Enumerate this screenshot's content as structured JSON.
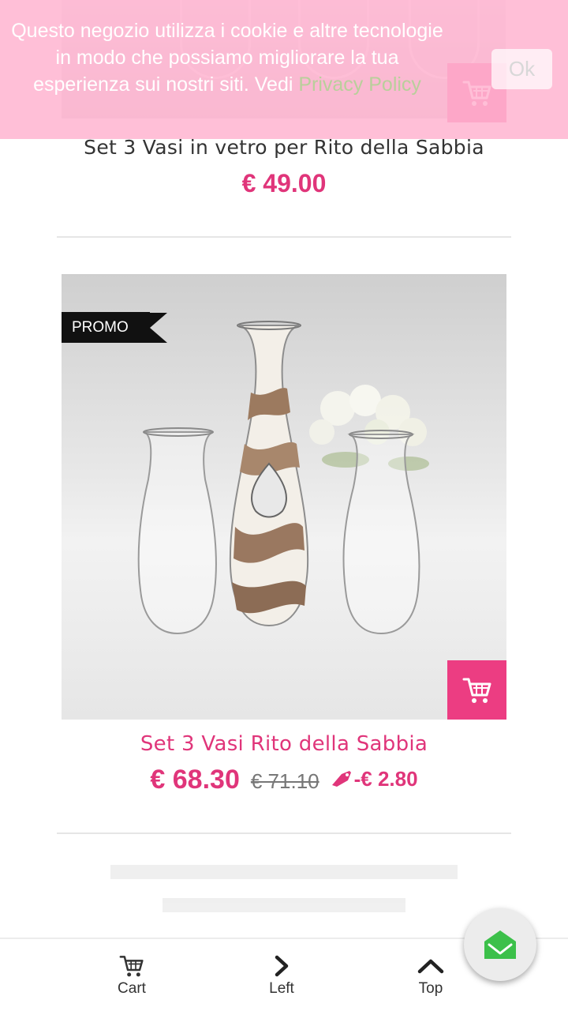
{
  "cookie_banner": {
    "text": "Questo negozio utilizza i cookie e altre tecnologie in modo che possiamo migliorare la tua esperienza sui nostri siti. Vedi ",
    "link_text": "Privacy Policy",
    "ok_label": "Ok"
  },
  "products": [
    {
      "title": "Set 3 Vasi in vetro per Rito della Sabbia",
      "price": "€ 49.00",
      "cart_icon": "cart-icon"
    },
    {
      "badge": "PROMO",
      "title": "Set 3 Vasi Rito della Sabbia",
      "price": "€ 68.30",
      "old_price": "€ 71.10",
      "discount": "-€ 2.80",
      "discount_icon": "tag-icon",
      "cart_icon": "cart-icon"
    }
  ],
  "bottom_bar": {
    "items": [
      {
        "label": "Cart",
        "icon": "cart-icon"
      },
      {
        "label": "Left",
        "icon": "chevron-right-icon"
      },
      {
        "label": "Top",
        "icon": "chevron-up-icon"
      }
    ]
  },
  "fab": {
    "icon": "envelope-icon"
  },
  "colors": {
    "accent": "#e0357a",
    "cart_button": "#ec3d82",
    "banner": "#ffb6d2",
    "fab_icon": "#3cc04a"
  }
}
